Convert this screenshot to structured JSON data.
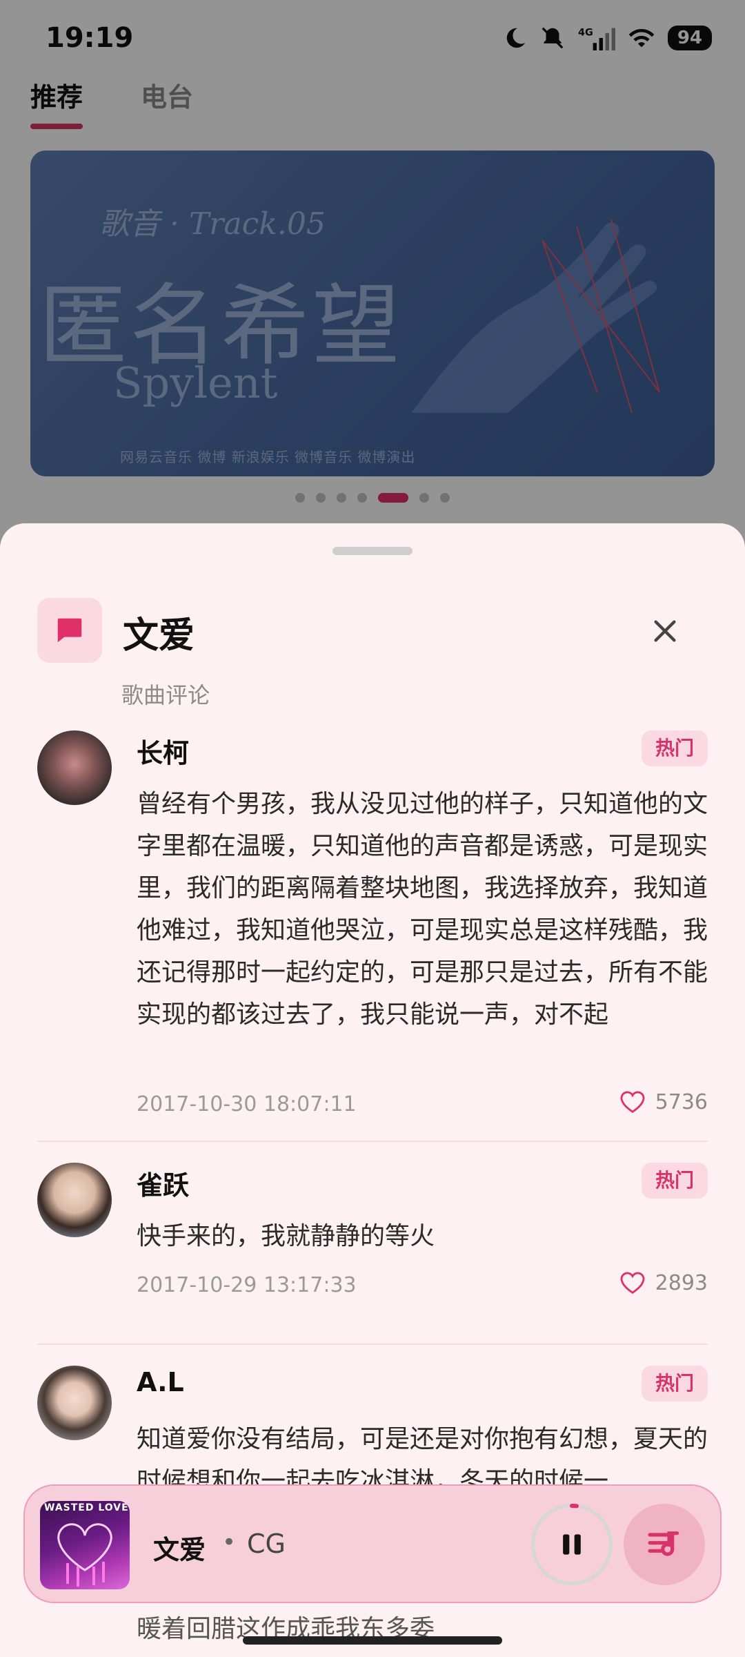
{
  "status_bar": {
    "time": "19:19",
    "network": "4G",
    "battery": "94"
  },
  "top_tabs": [
    {
      "label": "推荐"
    },
    {
      "label": "电台"
    }
  ],
  "banner": {
    "brand": "歌音 · Track.05",
    "title": "匿名希望",
    "subtitle": "Spylent",
    "logos": "网易云音乐   微博   新浪娱乐   微博音乐   微博演出"
  },
  "sheet": {
    "title": "文爱",
    "subtitle": "歌曲评论",
    "comments": [
      {
        "user": "长柯",
        "badge": "热门",
        "text": "曾经有个男孩，我从没见过他的样子，只知道他的文字里都在温暖，只知道他的声音都是诱惑，可是现实里，我们的距离隔着整块地图，我选择放弃，我知道他难过，我知道他哭泣，可是现实总是这样残酷，我还记得那时一起约定的，可是那只是过去，所有不能实现的都该过去了，我只能说一声，对不起",
        "time": "2017-10-30 18:07:11",
        "likes": "5736"
      },
      {
        "user": "雀跃",
        "badge": "热门",
        "text": "快手来的，我就静静的等火",
        "time": "2017-10-29 13:17:33",
        "likes": "2893"
      },
      {
        "user": "A.L",
        "badge": "热门",
        "text": "知道爱你没有结局，可是还是对你抱有幻想，夏天的时候想和你一起去吃冰淇淋，冬天的时候一"
      }
    ]
  },
  "player": {
    "album_text": "WASTED LOVE",
    "title": "文爱",
    "separator": "•",
    "artist": "CG",
    "under_text": "暖着回腊这作成乖我东多委"
  },
  "colors": {
    "accent": "#e0306a",
    "sheet_bg": "#fdf1f3",
    "badge_bg": "#fbd9e2"
  }
}
